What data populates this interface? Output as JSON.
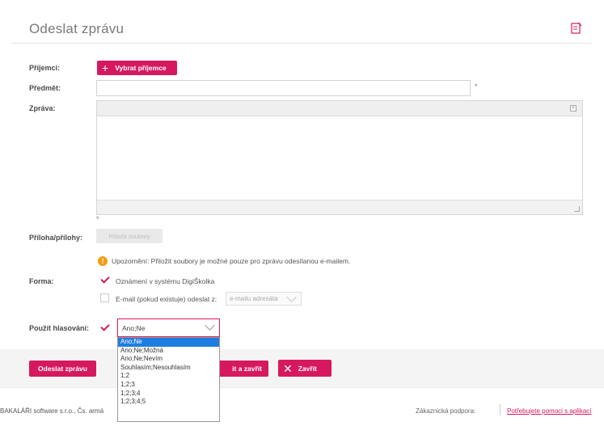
{
  "header": {
    "title": "Odeslat zprávu",
    "icon": "edit-note-icon"
  },
  "form": {
    "recipients_label": "Příjemci:",
    "add_recipient_button": "Vybrat příjemce",
    "subject_label": "Předmět:",
    "subject_value": "",
    "required_mark": "*",
    "message_label": "Zpráva:",
    "editor_expand": "+",
    "attachments_label": "Příloha/přílohy:",
    "attach_button": "Přiložit soubory",
    "warning_text": "Upozornění: Přiložit soubory je možné pouze pro zprávu odesílanou e-mailem.",
    "form_label": "Forma:",
    "option_system": "Oznámení v systému DigiŠkolka",
    "option_email": "E-mail (pokud existuje) odeslat z:",
    "email_source_value": "e-mailu adresáta",
    "vote_label": "Použít hlasování:",
    "vote_selected": "Ano;Ne",
    "vote_options": [
      "Ano;Ne",
      "Ano;Ne;Možná",
      "Ano;Ne;Nevím",
      "Souhlasím;Nesouhlasím",
      "1;2",
      "1;2;3",
      "1;2;3;4",
      "1;2;3;4;5"
    ]
  },
  "actions": {
    "send_button": "Odeslat zprávu",
    "save_close_button": "it a zavřít",
    "close_button": "Zavřít"
  },
  "footer": {
    "company": "BAKALÁŘI software s.r.o., Čs. armá",
    "support_label": "Zákaznická podpora:",
    "support_link": "Potřebujete pomoci s aplikací"
  },
  "colors": {
    "accent": "#d6195f",
    "warning": "#f39c12",
    "selection": "#1e7ee0"
  }
}
